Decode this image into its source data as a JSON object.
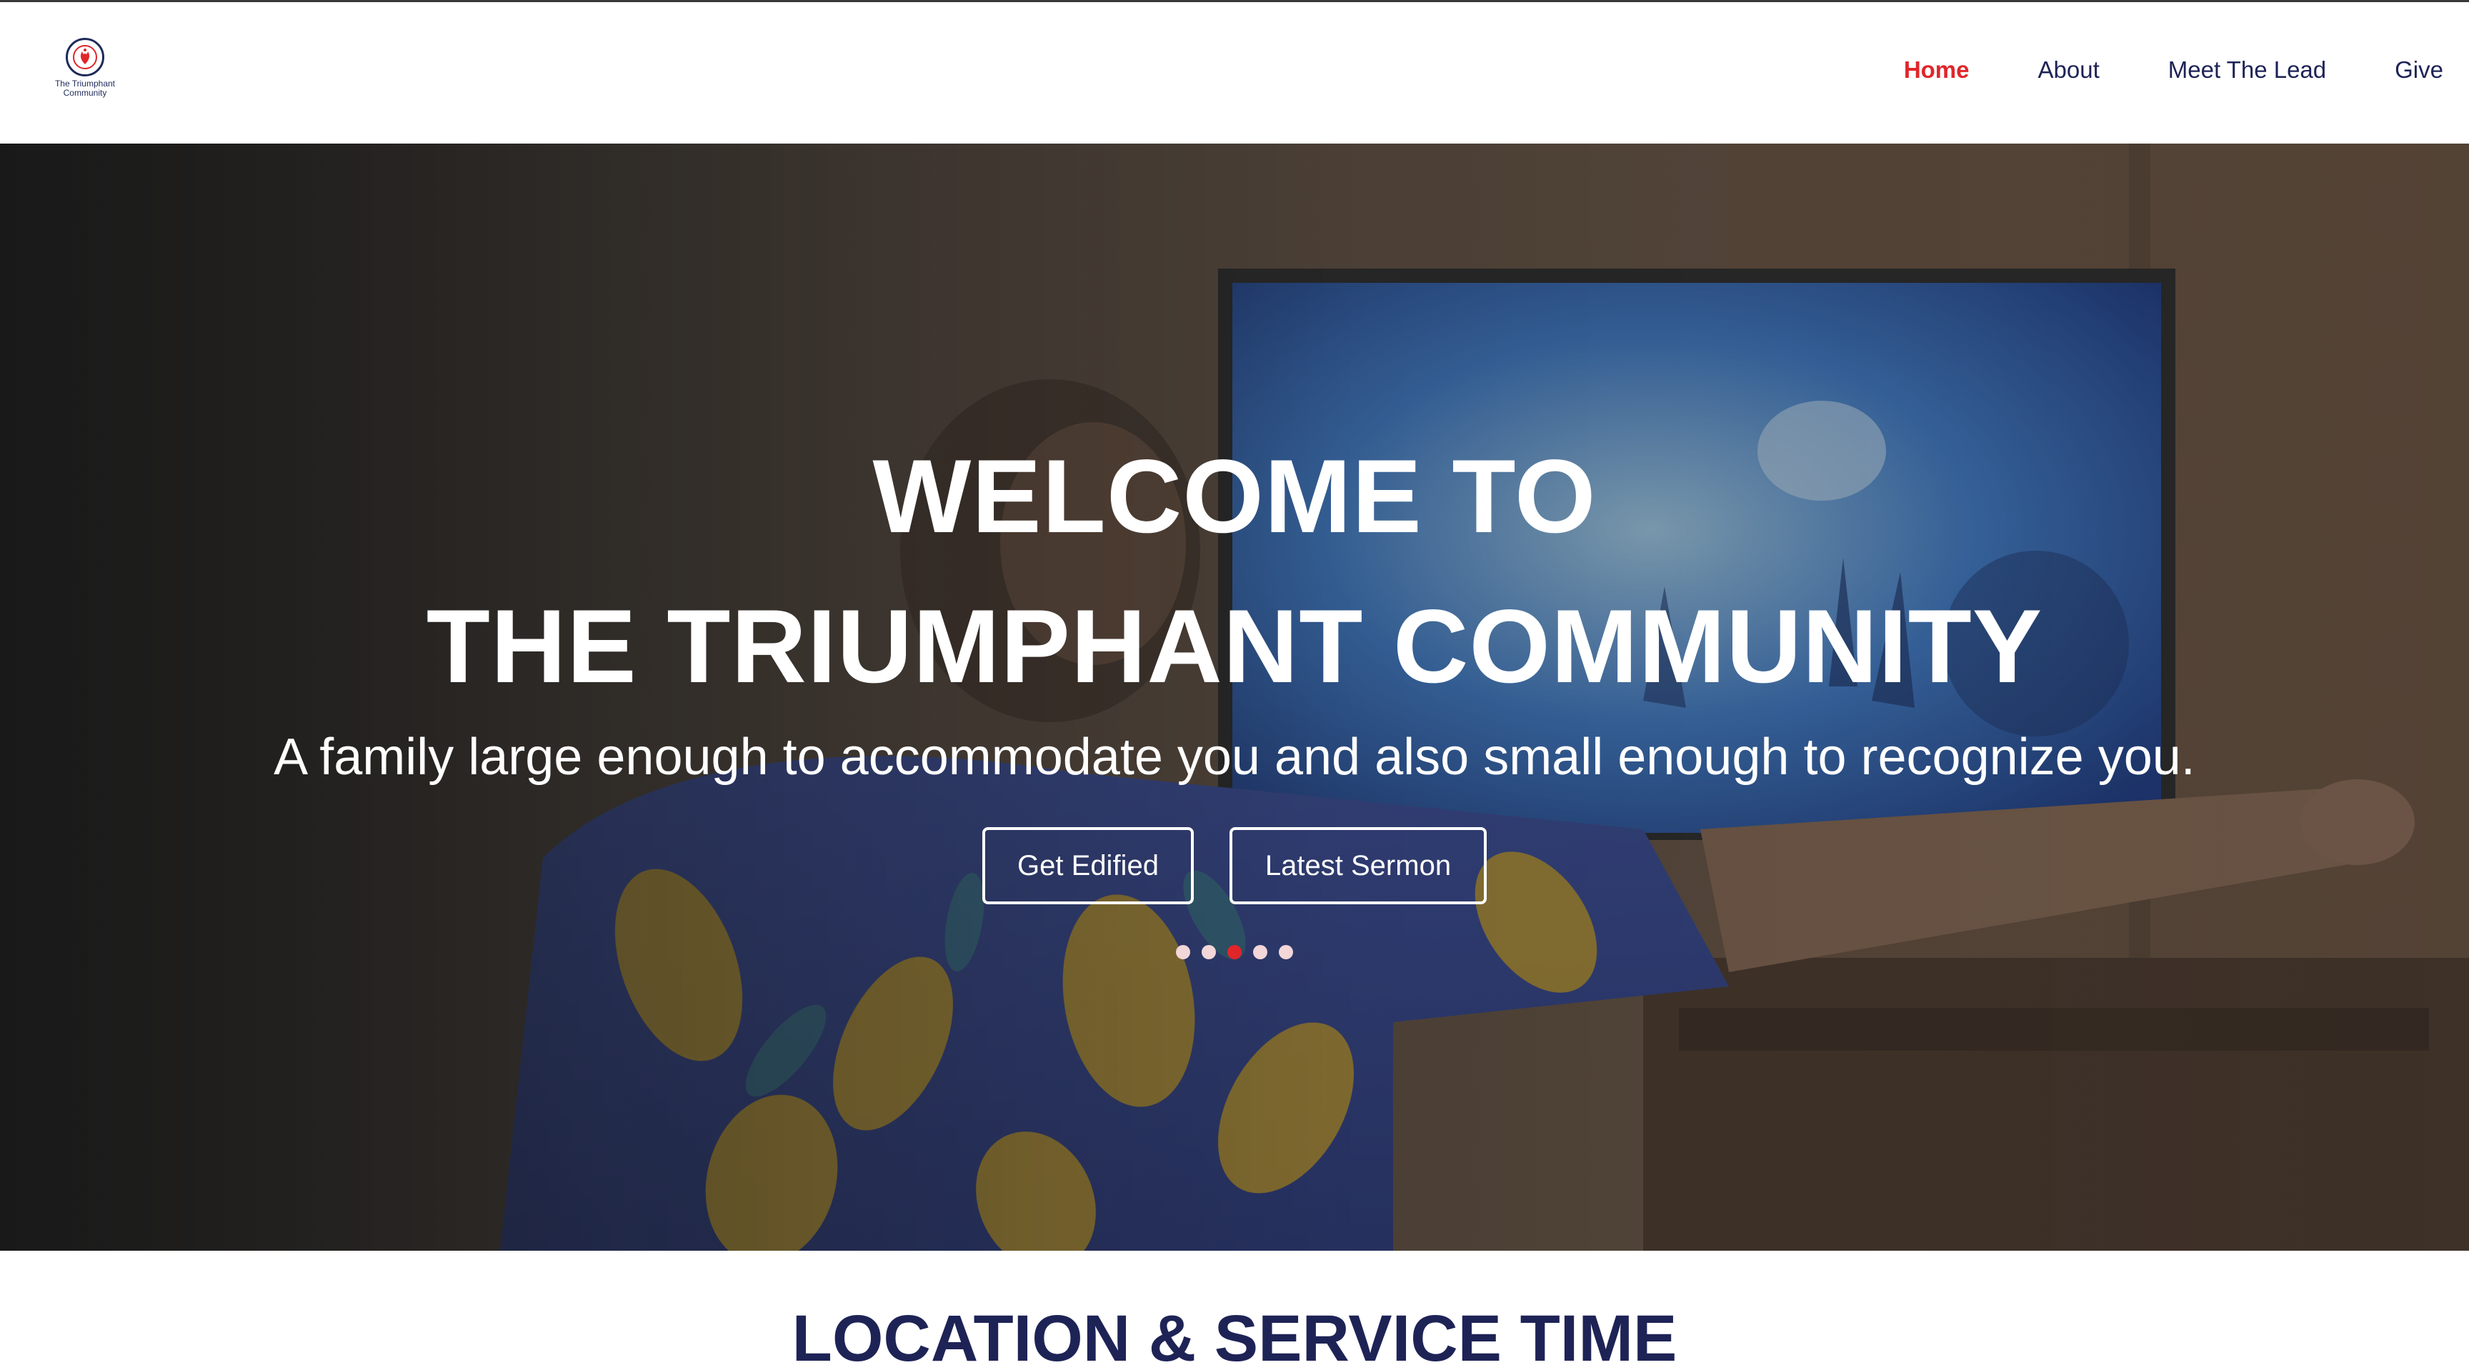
{
  "brand": {
    "name": "The Triumphant Community",
    "logo_text_line1": "The Triumphant",
    "logo_text_line2": "Community"
  },
  "nav": {
    "items": [
      {
        "label": "Home",
        "active": true
      },
      {
        "label": "About",
        "active": false
      },
      {
        "label": "Meet The Lead",
        "active": false
      },
      {
        "label": "Give",
        "active": false
      }
    ]
  },
  "hero": {
    "title_line1": "WELCOME TO",
    "title_line2": "THE TRIUMPHANT COMMUNITY",
    "subtitle": "A family large enough to accommodate you and also small enough to recognize you.",
    "buttons": {
      "primary": "Get Edified",
      "secondary": "Latest Sermon"
    },
    "carousel": {
      "slide_count": 5,
      "active_index": 2
    }
  },
  "location": {
    "title": "LOCATION & SERVICE TIME"
  },
  "colors": {
    "accent_red": "#e0262b",
    "navy": "#1e2356",
    "dot_inactive": "#f3d6d8"
  }
}
